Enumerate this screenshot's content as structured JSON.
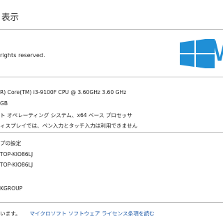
{
  "header": {
    "title": "表示"
  },
  "copyright": {
    "text": "rights reserved."
  },
  "system": {
    "processor": "R) Core(TM) i3-9100F CPU @ 3.60GHz   3.60 GHz",
    "memory": "GB",
    "system_type": "ト オペレーティング システム、x64 ベース プロセッサ",
    "pen_touch": "ィスプレイでは、ペン入力とタッチ入力は利用できません"
  },
  "computer": {
    "section_label": "プの設定",
    "computer_name": "TOP-KIO86LJ",
    "full_name": "TOP-KIO86LJ",
    "workgroup": "KGROUP"
  },
  "footer": {
    "prefix": "います。",
    "license_link": "マイクロソフト ソフトウェア ライセンス条項を読む"
  },
  "logo": {
    "letter": "W",
    "color": "#1f8fd6"
  }
}
